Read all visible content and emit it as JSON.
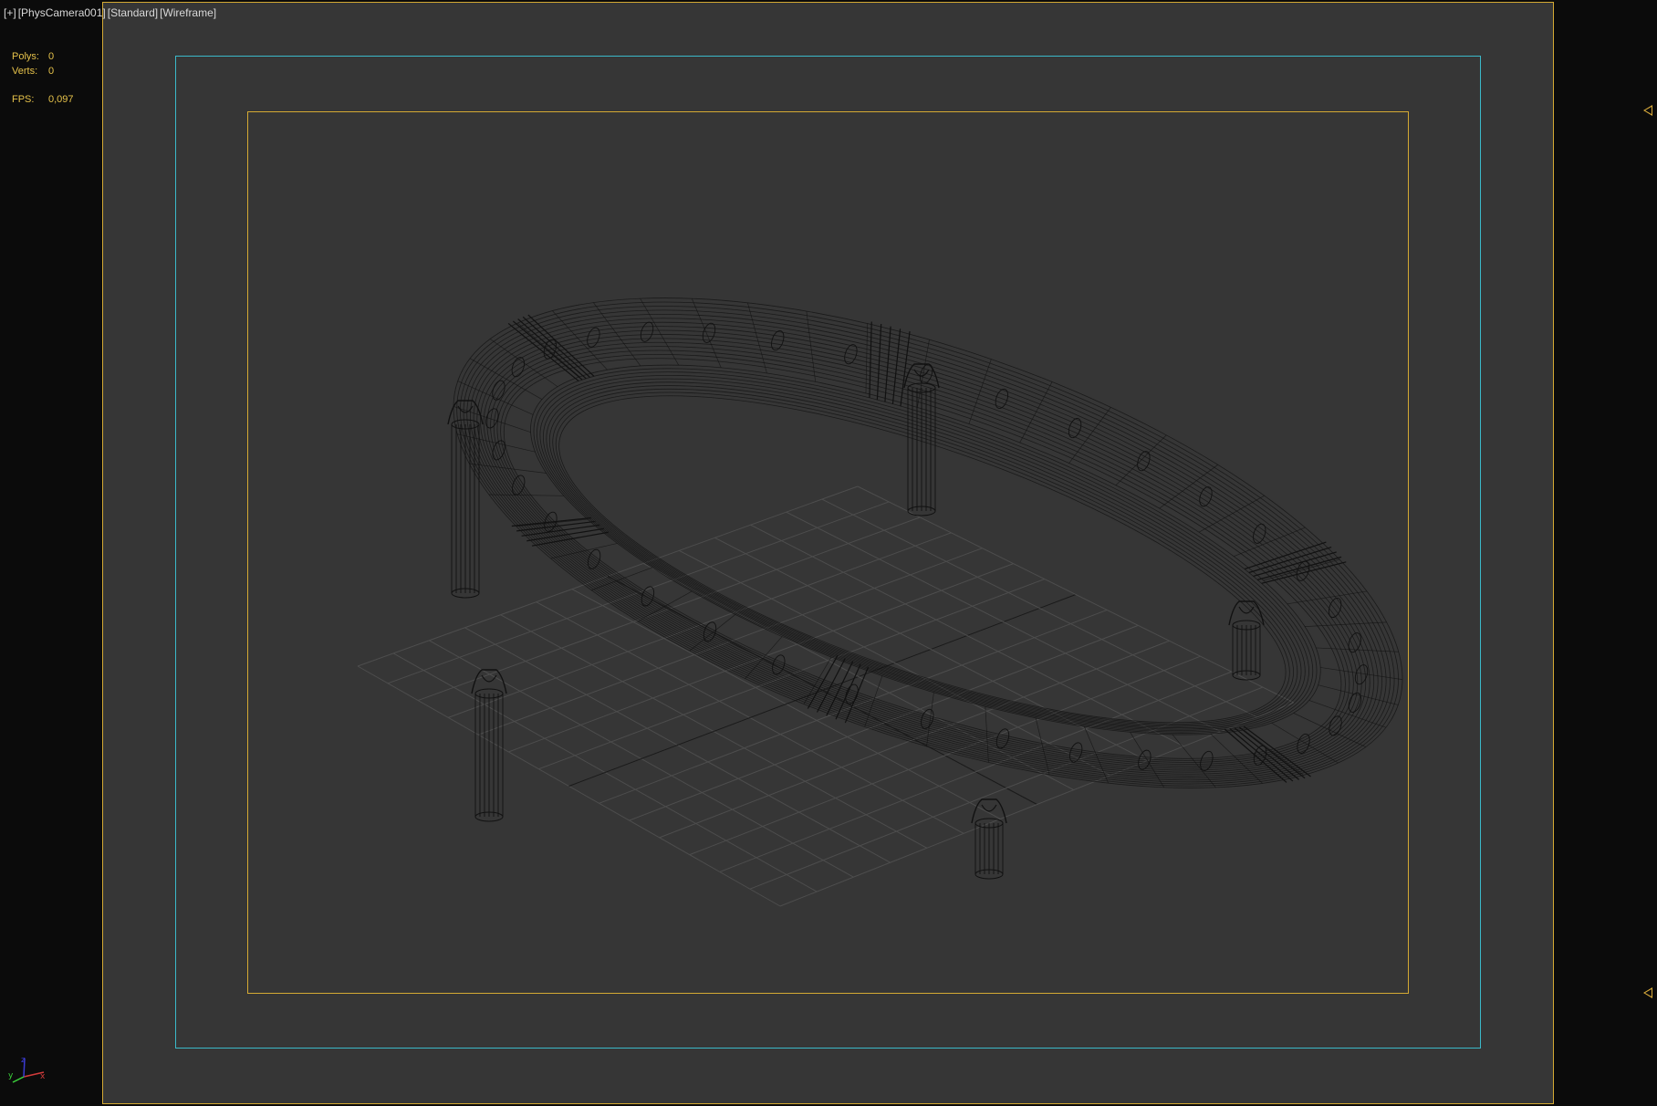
{
  "viewport": {
    "labels": {
      "plus": "[+]",
      "camera": "[PhysCamera001]",
      "shading_standard": "[Standard]",
      "shading_mode": "[Wireframe]"
    },
    "stats": {
      "polys_label": "Polys:",
      "polys_value": "0",
      "verts_label": "Verts:",
      "verts_value": "0",
      "fps_label": "FPS:",
      "fps_value": "0,097"
    },
    "axis_gizmo": {
      "x": "x",
      "y": "y",
      "z": "z"
    }
  },
  "colors": {
    "viewport_bg": "#363636",
    "outer_frame": "#0b0b0b",
    "safe_frame_outer": "#d4a933",
    "safe_frame_action": "#3bb9c9",
    "safe_frame_title": "#d4a933",
    "stats_text": "#e6c24a",
    "wire_dark": "#111111",
    "grid_line": "#4d4d4d",
    "grid_axis": "#1a1a1a",
    "axis_x": "#d23b3b",
    "axis_y": "#3bd23b",
    "axis_z": "#3b3bd2"
  },
  "icons": [
    "safe-frame-arrow-icon",
    "axis-gizmo-icon"
  ]
}
